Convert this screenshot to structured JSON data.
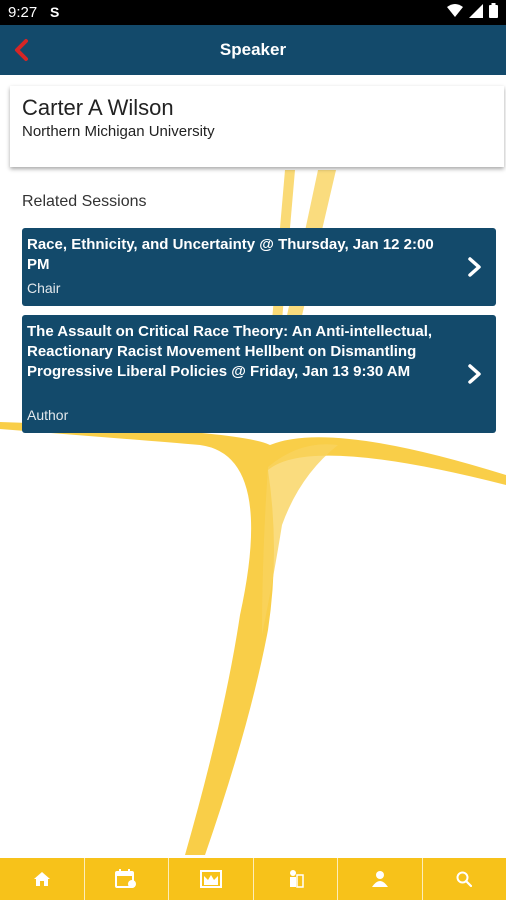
{
  "status_bar": {
    "time": "9:27",
    "app_indicator": "S"
  },
  "header": {
    "title": "Speaker",
    "back_icon": "chevron-left-icon"
  },
  "speaker": {
    "name": "Carter A Wilson",
    "affiliation": "Northern Michigan University"
  },
  "related_heading": "Related Sessions",
  "sessions": [
    {
      "title": "Race, Ethnicity, and Uncertainty @ Thursday, Jan 12 2:00 PM",
      "role": "Chair"
    },
    {
      "title": "The Assault on Critical Race Theory: An Anti-intellectual, Reactionary Racist Movement Hellbent on Dismantling Progressive Liberal Policies @ Friday, Jan 13 9:30 AM",
      "role": "Author"
    }
  ],
  "bottom_nav": [
    "home-icon",
    "calendar-icon",
    "exhibit-icon",
    "poster-icon",
    "speaker-icon",
    "search-icon"
  ],
  "colors": {
    "header": "#134a6b",
    "accent_yellow": "#f7c21a",
    "back_arrow": "#d62626",
    "card_bg": "#134a6b"
  }
}
